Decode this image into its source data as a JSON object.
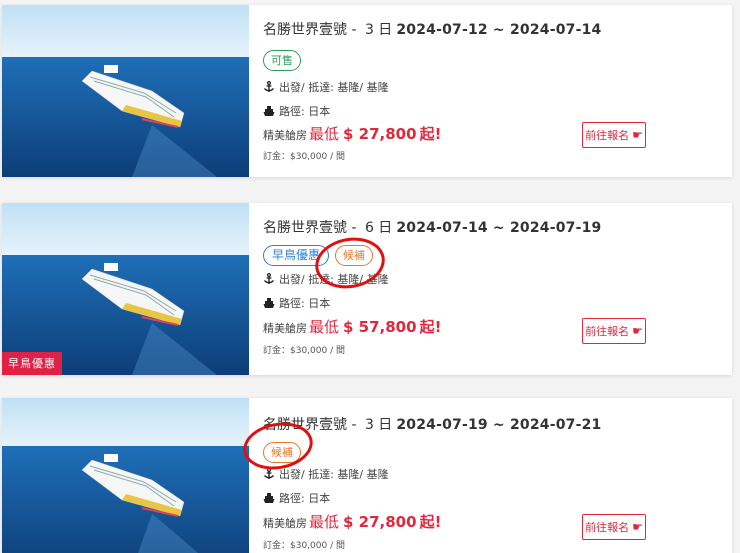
{
  "cards": [
    {
      "ship": "名勝世界壹號",
      "days": "3 日",
      "dates": "2024-07-12 ~ 2024-07-14",
      "badges": [
        {
          "text": "可售",
          "style": "green"
        }
      ],
      "route_ports": "出發/ 抵達: 基隆/ 基隆",
      "route_path": "路徑: 日本",
      "price_label": "精美艙房",
      "price_low": "最低",
      "price": "$ 27,800",
      "price_suffix": "起!",
      "deposit": "訂金：$30,000 / 間",
      "button": "前往報名",
      "ribbon": ""
    },
    {
      "ship": "名勝世界壹號",
      "days": "6 日",
      "dates": "2024-07-14 ~ 2024-07-19",
      "badges": [
        {
          "text": "早鳥優惠",
          "style": "blue"
        },
        {
          "text": "候補",
          "style": "orange"
        }
      ],
      "route_ports": "出發/ 抵達: 基隆/ 基隆",
      "route_path": "路徑: 日本",
      "price_label": "精美艙房",
      "price_low": "最低",
      "price": "$ 57,800",
      "price_suffix": "起!",
      "deposit": "訂金：$30,000 / 間",
      "button": "前往報名",
      "ribbon": "早鳥優惠"
    },
    {
      "ship": "名勝世界壹號",
      "days": "3 日",
      "dates": "2024-07-19 ~ 2024-07-21",
      "badges": [
        {
          "text": "候補",
          "style": "orange"
        }
      ],
      "route_ports": "出發/ 抵達: 基隆/ 基隆",
      "route_path": "路徑: 日本",
      "price_label": "精美艙房",
      "price_low": "最低",
      "price": "$ 27,800",
      "price_suffix": "起!",
      "deposit": "訂金：$30,000 / 間",
      "button": "前往報名",
      "ribbon": ""
    }
  ],
  "colors": {
    "accent": "#e0283c",
    "annotation": "#e01010",
    "green": "#2a9d5c",
    "orange": "#e07b2b",
    "blue": "#2f7fd1"
  },
  "icons": {
    "anchor": "anchor-icon",
    "ship": "ship-icon",
    "hand": "pointing-hand-icon"
  }
}
